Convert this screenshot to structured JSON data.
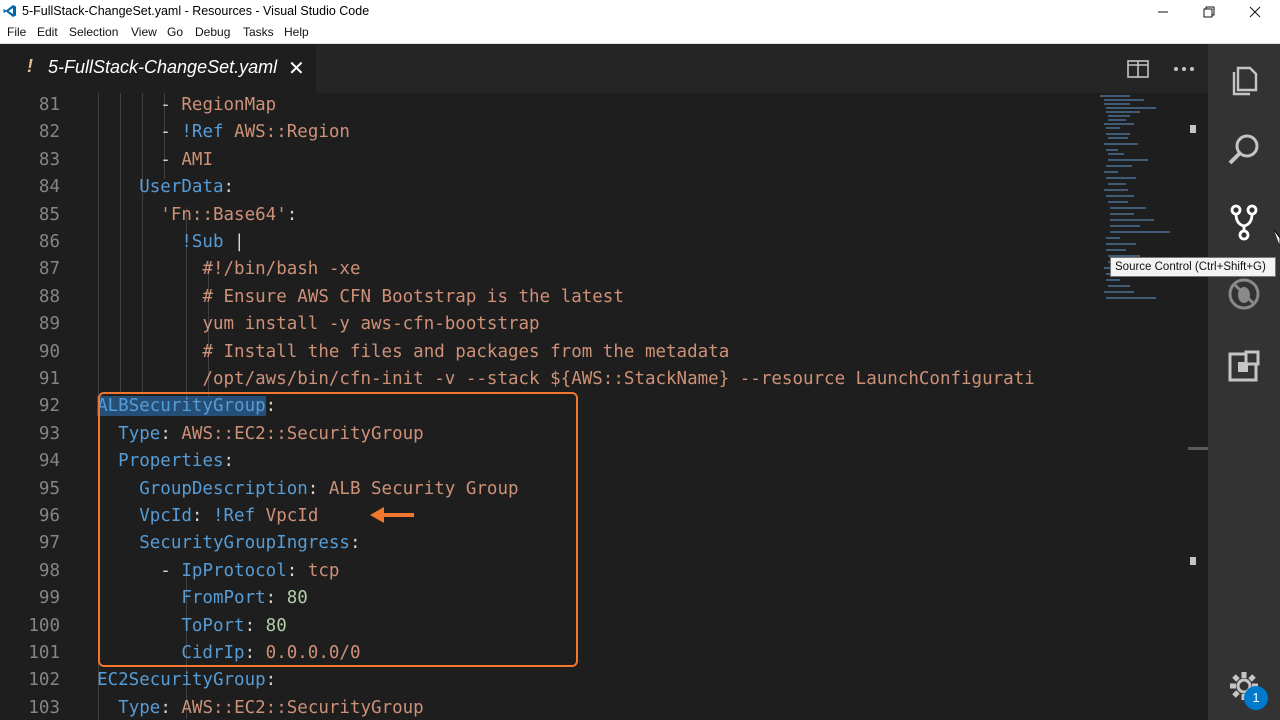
{
  "window": {
    "title": "5-FullStack-ChangeSet.yaml - Resources - Visual Studio Code",
    "icon": "vscode-logo-icon",
    "controls": [
      "minimize-icon",
      "restore-icon",
      "close-icon"
    ]
  },
  "menu": {
    "items": [
      "File",
      "Edit",
      "Selection",
      "View",
      "Go",
      "Debug",
      "Tasks",
      "Help"
    ]
  },
  "tab": {
    "modified_marker": "!",
    "label": "5-FullStack-ChangeSet.yaml",
    "close": "✕"
  },
  "editor": {
    "lines": [
      {
        "n": "81",
        "segs": [
          [
            "p",
            "- "
          ],
          [
            "s",
            "RegionMap"
          ]
        ],
        "indent": "        "
      },
      {
        "n": "82",
        "segs": [
          [
            "p",
            "- "
          ],
          [
            "k",
            "!Ref "
          ],
          [
            "s",
            "AWS::Region"
          ]
        ],
        "indent": "        "
      },
      {
        "n": "83",
        "segs": [
          [
            "p",
            "- "
          ],
          [
            "s",
            "AMI"
          ]
        ],
        "indent": "        "
      },
      {
        "n": "84",
        "segs": [
          [
            "k",
            "UserData"
          ],
          [
            "p",
            ":"
          ]
        ],
        "indent": "      "
      },
      {
        "n": "85",
        "segs": [
          [
            "s",
            "'Fn::Base64'"
          ],
          [
            "p",
            ":"
          ]
        ],
        "indent": "        "
      },
      {
        "n": "86",
        "segs": [
          [
            "k",
            "!Sub "
          ],
          [
            "p",
            "|"
          ]
        ],
        "indent": "          "
      },
      {
        "n": "87",
        "segs": [
          [
            "s",
            "#!/bin/bash -xe"
          ]
        ],
        "indent": "            "
      },
      {
        "n": "88",
        "segs": [
          [
            "s",
            "# Ensure AWS CFN Bootstrap is the latest"
          ]
        ],
        "indent": "            "
      },
      {
        "n": "89",
        "segs": [
          [
            "s",
            "yum install -y aws-cfn-bootstrap"
          ]
        ],
        "indent": "            "
      },
      {
        "n": "90",
        "segs": [
          [
            "s",
            "# Install the files and packages from the metadata"
          ]
        ],
        "indent": "            "
      },
      {
        "n": "91",
        "segs": [
          [
            "s",
            "/opt/aws/bin/cfn-init -v --stack ${AWS::StackName} --resource LaunchConfigurati"
          ]
        ],
        "indent": "            "
      },
      {
        "n": "92",
        "segs": [
          [
            "sel",
            "ALBSecurityGroup"
          ],
          [
            "p",
            ":"
          ]
        ],
        "indent": "  "
      },
      {
        "n": "93",
        "segs": [
          [
            "k",
            "Type"
          ],
          [
            "p",
            ": "
          ],
          [
            "s",
            "AWS::EC2::SecurityGroup"
          ]
        ],
        "indent": "    "
      },
      {
        "n": "94",
        "segs": [
          [
            "k",
            "Properties"
          ],
          [
            "p",
            ":"
          ]
        ],
        "indent": "    "
      },
      {
        "n": "95",
        "segs": [
          [
            "k",
            "GroupDescription"
          ],
          [
            "p",
            ": "
          ],
          [
            "s",
            "ALB Security Group"
          ]
        ],
        "indent": "      "
      },
      {
        "n": "96",
        "segs": [
          [
            "k",
            "VpcId"
          ],
          [
            "p",
            ": "
          ],
          [
            "k",
            "!Ref "
          ],
          [
            "s",
            "VpcId"
          ]
        ],
        "indent": "      "
      },
      {
        "n": "97",
        "segs": [
          [
            "k",
            "SecurityGroupIngress"
          ],
          [
            "p",
            ":"
          ]
        ],
        "indent": "      "
      },
      {
        "n": "98",
        "segs": [
          [
            "p",
            "- "
          ],
          [
            "k",
            "IpProtocol"
          ],
          [
            "p",
            ": "
          ],
          [
            "s",
            "tcp"
          ]
        ],
        "indent": "        "
      },
      {
        "n": "99",
        "segs": [
          [
            "k",
            "FromPort"
          ],
          [
            "p",
            ": "
          ],
          [
            "n",
            "80"
          ]
        ],
        "indent": "          "
      },
      {
        "n": "100",
        "segs": [
          [
            "k",
            "ToPort"
          ],
          [
            "p",
            ": "
          ],
          [
            "n",
            "80"
          ]
        ],
        "indent": "          "
      },
      {
        "n": "101",
        "segs": [
          [
            "k",
            "CidrIp"
          ],
          [
            "p",
            ": "
          ],
          [
            "s",
            "0.0.0.0/0"
          ]
        ],
        "indent": "          "
      },
      {
        "n": "102",
        "segs": [
          [
            "k",
            "EC2SecurityGroup"
          ],
          [
            "p",
            ":"
          ]
        ],
        "indent": "  "
      },
      {
        "n": "103",
        "segs": [
          [
            "k",
            "Type"
          ],
          [
            "p",
            ": "
          ],
          [
            "s",
            "AWS::EC2::SecurityGroup"
          ]
        ],
        "indent": "    "
      }
    ]
  },
  "annotation": {
    "highlight_color": "#f0772d",
    "arrow_icon": "left-arrow-icon"
  },
  "activity_bar": {
    "icons": [
      "explorer-icon",
      "search-icon",
      "source-control-icon",
      "debug-icon",
      "extensions-icon",
      "settings-gear-icon"
    ],
    "tooltip": "Source Control (Ctrl+Shift+G)",
    "badge": "1"
  },
  "colors": {
    "keyword": "#569cd6",
    "string": "#ce9178",
    "number": "#b5cea8",
    "background": "#1e1e1e",
    "selection": "#264f78"
  }
}
